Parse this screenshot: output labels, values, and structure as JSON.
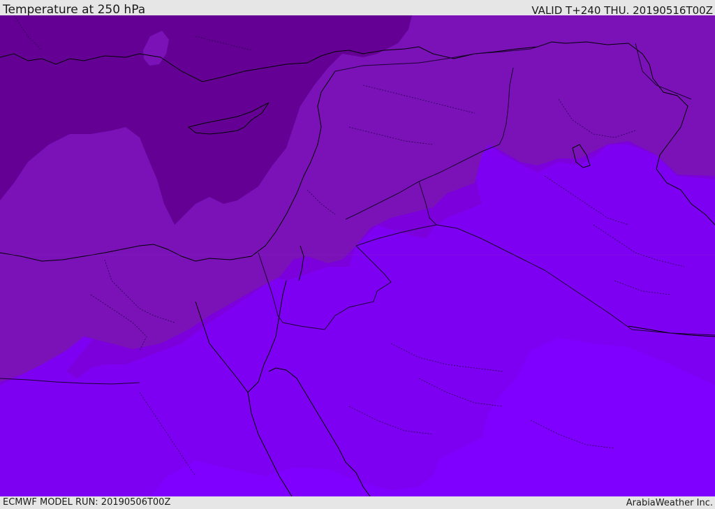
{
  "header": {
    "title": "Temperature at 250 hPa",
    "valid_time": "VALID T+240 THU. 20190516T00Z"
  },
  "footer": {
    "model_run": "ECMWF MODEL RUN: 20190506T00Z",
    "credit": "ArabiaWeather Inc."
  },
  "map": {
    "colors": {
      "coldest_band": "#650095",
      "cold_band": "#7a12b8",
      "mid_band": "#7b00dc",
      "warm_band": "#7d00f2",
      "warmest_band": "#7f00ff",
      "coastline": "#000000",
      "border": "#1a0030"
    }
  }
}
